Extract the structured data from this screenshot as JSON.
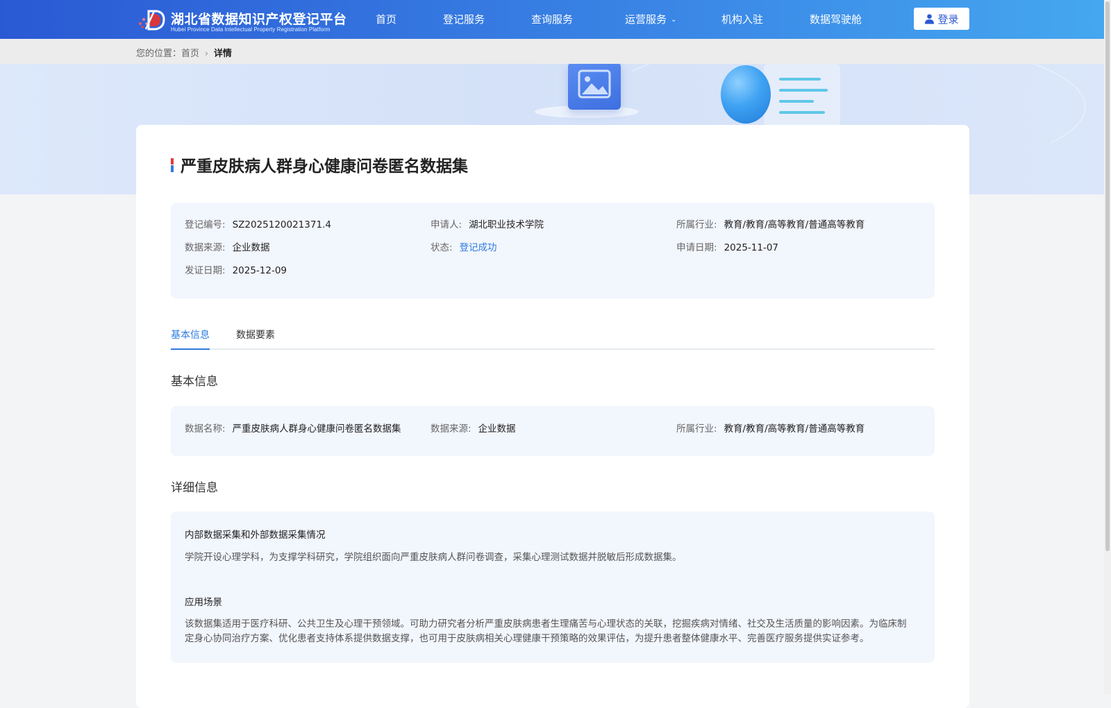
{
  "header": {
    "logo_cn": "湖北省数据知识产权登记平台",
    "logo_en": "Hubei Province Data Intellectual Property Registration Platform",
    "nav": [
      {
        "label": "首页"
      },
      {
        "label": "登记服务"
      },
      {
        "label": "查询服务"
      },
      {
        "label": "运营服务",
        "has_dropdown": true
      },
      {
        "label": "机构入驻"
      },
      {
        "label": "数据驾驶舱"
      }
    ],
    "login_label": "登录"
  },
  "breadcrumb": {
    "prefix": "您的位置：",
    "home": "首页",
    "current": "详情"
  },
  "detail": {
    "title": "严重皮肤病人群身心健康问卷匿名数据集",
    "summary": [
      {
        "key": "登记编号:",
        "value": "SZ2025120021371.4"
      },
      {
        "key": "申请人:",
        "value": "湖北职业技术学院"
      },
      {
        "key": "所属行业:",
        "value": "教育/教育/高等教育/普通高等教育"
      },
      {
        "key": "数据来源:",
        "value": "企业数据"
      },
      {
        "key": "状态:",
        "value": "登记成功"
      },
      {
        "key": "申请日期:",
        "value": "2025-11-07"
      },
      {
        "key": "发证日期:",
        "value": "2025-12-09"
      }
    ]
  },
  "tabs": [
    {
      "label": "基本信息",
      "active": true
    },
    {
      "label": "数据要素",
      "active": false
    }
  ],
  "basic_info": {
    "heading": "基本信息",
    "fields": [
      {
        "key": "数据名称:",
        "value": "严重皮肤病人群身心健康问卷匿名数据集"
      },
      {
        "key": "数据来源:",
        "value": "企业数据"
      },
      {
        "key": "所属行业:",
        "value": "教育/教育/高等教育/普通高等教育"
      }
    ]
  },
  "detail_info": {
    "heading": "详细信息",
    "sections": [
      {
        "title": "内部数据采集和外部数据采集情况",
        "text": "学院开设心理学科，为支撑学科研究，学院组织面向严重皮肤病人群问卷调查，采集心理测试数据并脱敏后形成数据集。"
      },
      {
        "title": "应用场景",
        "text": "该数据集适用于医疗科研、公共卫生及心理干预领域。可助力研究者分析严重皮肤病患者生理痛苦与心理状态的关联，挖掘疾病对情绪、社交及生活质量的影响因素。为临床制定身心协同治疗方案、优化患者支持体系提供数据支撑，也可用于皮肤病相关心理健康干预策略的效果评估，为提升患者整体健康水平、完善医疗服务提供实证参考。"
      }
    ]
  },
  "colors": {
    "nav_gradient_start": "#2a59d4",
    "nav_gradient_end": "#45a8ef",
    "accent": "#2f7be0",
    "panel_bg": "#f2f6fd"
  },
  "icons": [
    "logo-mark-icon",
    "chevron-down-icon",
    "user-icon",
    "chevron-right-icon"
  ]
}
